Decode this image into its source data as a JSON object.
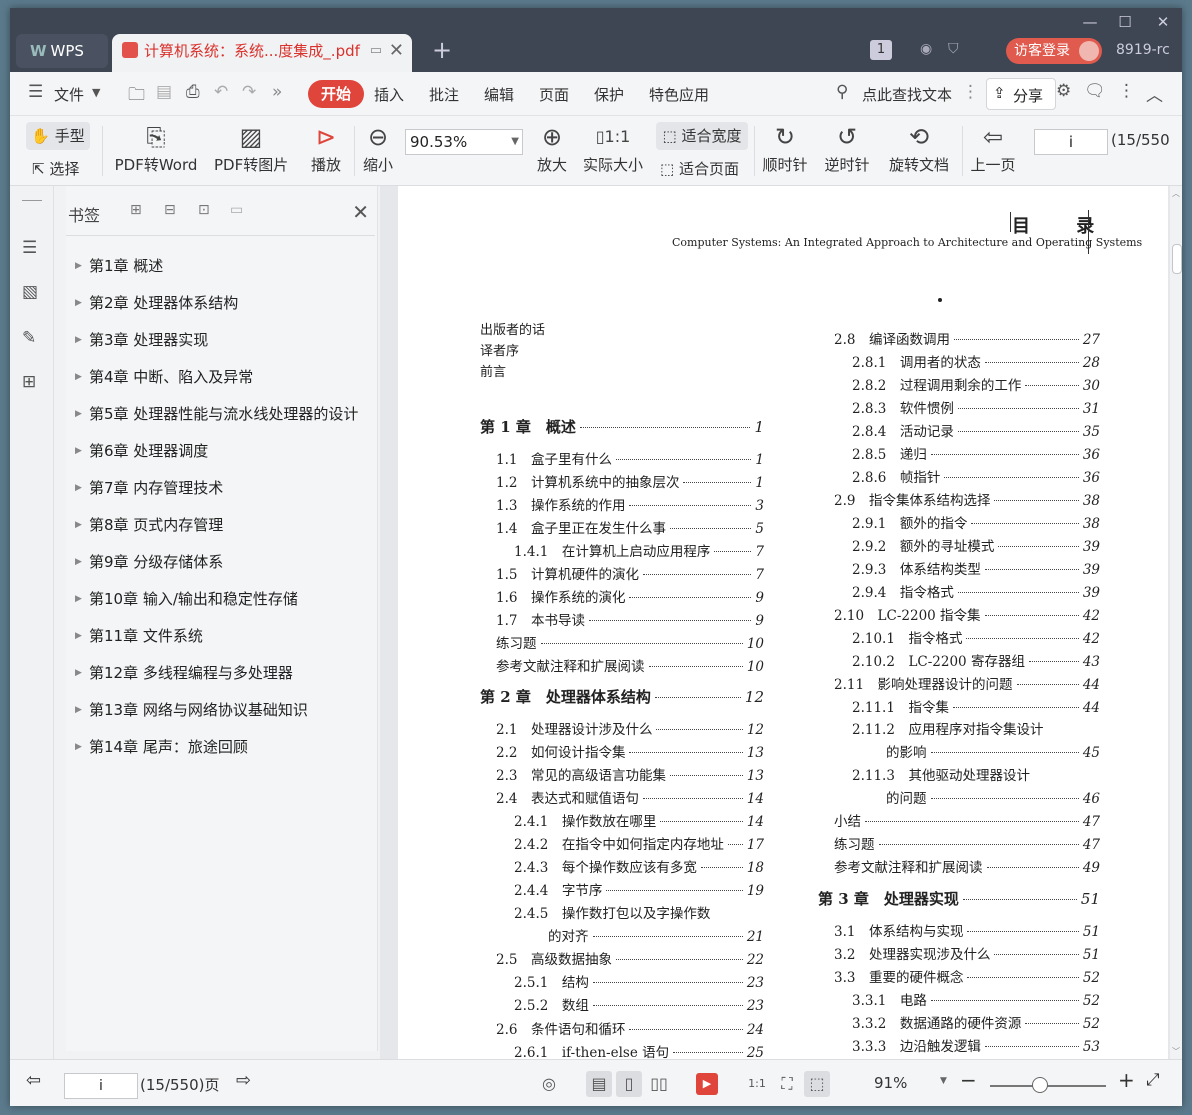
{
  "window": {
    "controls": [
      "—",
      "☐",
      "✕"
    ]
  },
  "tabs": {
    "wps_label": "WPS",
    "doc_label": "计算机系统：系统...度集成_.pdf",
    "new_tab": "+"
  },
  "titlebar": {
    "badge": "1",
    "login_label": "访客登录",
    "user_id": "8919-rc"
  },
  "menu": {
    "file": "文件",
    "tabs": [
      "开始",
      "插入",
      "批注",
      "编辑",
      "页面",
      "保护",
      "特色应用"
    ],
    "search": "点此查找文本",
    "share": "分享"
  },
  "toolbar": {
    "hand": "手型",
    "select": "选择",
    "pdf_to_word": "PDF转Word",
    "pdf_to_image": "PDF转图片",
    "play": "播放",
    "zoom_out": "缩小",
    "zoom_value": "90.53%",
    "zoom_in": "放大",
    "actual_size": "实际大小",
    "fit_width": "适合宽度",
    "fit_page": "适合页面",
    "clockwise": "顺时针",
    "counterclockwise": "逆时针",
    "rotate_doc": "旋转文档",
    "prev_page": "上一页",
    "page_input": "i",
    "page_count": "(15/550"
  },
  "bookmarks": {
    "title": "书签",
    "items": [
      "第1章  概述",
      "第2章  处理器体系结构",
      "第3章  处理器实现",
      "第4章  中断、陷入及异常",
      "第5章  处理器性能与流水线处理器的设计",
      "第6章  处理器调度",
      "第7章  内存管理技术",
      "第8章  页式内存管理",
      "第9章  分级存储体系",
      "第10章  输入/输出和稳定性存储",
      "第11章  文件系统",
      "第12章  多线程编程与多处理器",
      "第13章  网络与网络协议基础知识",
      "第14章  尾声：旅途回顾"
    ]
  },
  "page": {
    "header_title": "目  录",
    "header_subtitle": "Computer Systems: An Integrated Approach to Architecture and Operating Systems",
    "front_matter": [
      "出版者的话",
      "译者序",
      "前言"
    ],
    "left_column": [
      {
        "label": "第 1 章　概述",
        "page": "1",
        "level": 0
      },
      {
        "label": "1.1　盒子里有什么",
        "page": "1",
        "level": 1
      },
      {
        "label": "1.2　计算机系统中的抽象层次",
        "page": "1",
        "level": 1
      },
      {
        "label": "1.3　操作系统的作用",
        "page": "3",
        "level": 1
      },
      {
        "label": "1.4　盒子里正在发生什么事",
        "page": "5",
        "level": 1
      },
      {
        "label": "1.4.1　在计算机上启动应用程序",
        "page": "7",
        "level": 2
      },
      {
        "label": "1.5　计算机硬件的演化",
        "page": "7",
        "level": 1
      },
      {
        "label": "1.6　操作系统的演化",
        "page": "9",
        "level": 1
      },
      {
        "label": "1.7　本书导读",
        "page": "9",
        "level": 1
      },
      {
        "label": "练习题",
        "page": "10",
        "level": 1
      },
      {
        "label": "参考文献注释和扩展阅读",
        "page": "10",
        "level": 1
      },
      {
        "label": "第 2 章　处理器体系结构",
        "page": "12",
        "level": 0
      },
      {
        "label": "2.1　处理器设计涉及什么",
        "page": "12",
        "level": 1
      },
      {
        "label": "2.2　如何设计指令集",
        "page": "13",
        "level": 1
      },
      {
        "label": "2.3　常见的高级语言功能集",
        "page": "13",
        "level": 1
      },
      {
        "label": "2.4　表达式和赋值语句",
        "page": "14",
        "level": 1
      },
      {
        "label": "2.4.1　操作数放在哪里",
        "page": "14",
        "level": 2
      },
      {
        "label": "2.4.2　在指令中如何指定内存地址",
        "page": "17",
        "level": 2
      },
      {
        "label": "2.4.3　每个操作数应该有多宽",
        "page": "18",
        "level": 2
      },
      {
        "label": "2.4.4　字节序",
        "page": "19",
        "level": 2
      },
      {
        "label": "2.4.5　操作数打包以及字操作数",
        "page": "",
        "level": 2
      },
      {
        "label": "的对齐",
        "page": "21",
        "level": 3
      },
      {
        "label": "2.5　高级数据抽象",
        "page": "22",
        "level": 1
      },
      {
        "label": "2.5.1　结构",
        "page": "23",
        "level": 2
      },
      {
        "label": "2.5.2　数组",
        "page": "23",
        "level": 2
      },
      {
        "label": "2.6　条件语句和循环",
        "page": "24",
        "level": 1
      },
      {
        "label": "2.6.1　if-then-else 语句",
        "page": "25",
        "level": 2
      }
    ],
    "right_column": [
      {
        "label": "2.8　编译函数调用",
        "page": "27",
        "level": 1
      },
      {
        "label": "2.8.1　调用者的状态",
        "page": "28",
        "level": 2
      },
      {
        "label": "2.8.2　过程调用剩余的工作",
        "page": "30",
        "level": 2
      },
      {
        "label": "2.8.3　软件惯例",
        "page": "31",
        "level": 2
      },
      {
        "label": "2.8.4　活动记录",
        "page": "35",
        "level": 2
      },
      {
        "label": "2.8.5　递归",
        "page": "36",
        "level": 2
      },
      {
        "label": "2.8.6　帧指针",
        "page": "36",
        "level": 2
      },
      {
        "label": "2.9　指令集体系结构选择",
        "page": "38",
        "level": 1
      },
      {
        "label": "2.9.1　额外的指令",
        "page": "38",
        "level": 2
      },
      {
        "label": "2.9.2　额外的寻址模式",
        "page": "39",
        "level": 2
      },
      {
        "label": "2.9.3　体系结构类型",
        "page": "39",
        "level": 2
      },
      {
        "label": "2.9.4　指令格式",
        "page": "39",
        "level": 2
      },
      {
        "label": "2.10　LC-2200 指令集",
        "page": "42",
        "level": 1
      },
      {
        "label": "2.10.1　指令格式",
        "page": "42",
        "level": 2
      },
      {
        "label": "2.10.2　LC-2200 寄存器组",
        "page": "43",
        "level": 2
      },
      {
        "label": "2.11　影响处理器设计的问题",
        "page": "44",
        "level": 1
      },
      {
        "label": "2.11.1　指令集",
        "page": "44",
        "level": 2
      },
      {
        "label": "2.11.2　应用程序对指令集设计",
        "page": "",
        "level": 2
      },
      {
        "label": "的影响",
        "page": "45",
        "level": 3
      },
      {
        "label": "2.11.3　其他驱动处理器设计",
        "page": "",
        "level": 2
      },
      {
        "label": "的问题",
        "page": "46",
        "level": 3
      },
      {
        "label": "小结",
        "page": "47",
        "level": 1
      },
      {
        "label": "练习题",
        "page": "47",
        "level": 1
      },
      {
        "label": "参考文献注释和扩展阅读",
        "page": "49",
        "level": 1
      },
      {
        "label": "第 3 章　处理器实现",
        "page": "51",
        "level": 0
      },
      {
        "label": "3.1　体系结构与实现",
        "page": "51",
        "level": 1
      },
      {
        "label": "3.2　处理器实现涉及什么",
        "page": "51",
        "level": 1
      },
      {
        "label": "3.3　重要的硬件概念",
        "page": "52",
        "level": 1
      },
      {
        "label": "3.3.1　电路",
        "page": "52",
        "level": 2
      },
      {
        "label": "3.3.2　数据通路的硬件资源",
        "page": "52",
        "level": 2
      },
      {
        "label": "3.3.3　边沿触发逻辑",
        "page": "53",
        "level": 2
      }
    ]
  },
  "statusbar": {
    "page_input": "i",
    "page_count": "(15/550)页",
    "zoom": "91%"
  }
}
